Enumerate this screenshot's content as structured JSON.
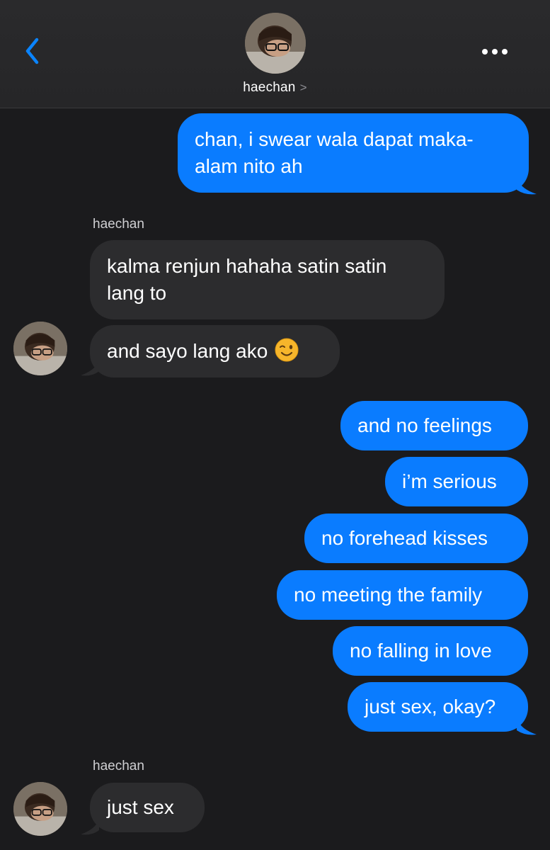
{
  "header": {
    "contact_name": "haechan",
    "chevron": ">"
  },
  "messages": {
    "m1": {
      "line1": "chan, i swear wala dapat maka-",
      "line2": "alam nito ah"
    },
    "sender_label_1": "haechan",
    "m2": {
      "line1": "kalma renjun hahaha satin satin",
      "line2": "lang to"
    },
    "m3": {
      "text": "and sayo lang ako",
      "emoji": "winking-face"
    },
    "m4": {
      "text": "and no feelings"
    },
    "m5": {
      "text": "i’m serious"
    },
    "m6": {
      "text": "no forehead kisses"
    },
    "m7": {
      "text": "no meeting the family"
    },
    "m8": {
      "text": "no falling in love"
    },
    "m9": {
      "text": "just sex, okay?"
    },
    "sender_label_2": "haechan",
    "m10": {
      "text": "just sex"
    }
  },
  "colors": {
    "outgoing_bubble": "#0a7cff",
    "incoming_bubble": "#2c2c2e",
    "background": "#1b1b1d",
    "accent": "#0a84ff"
  }
}
